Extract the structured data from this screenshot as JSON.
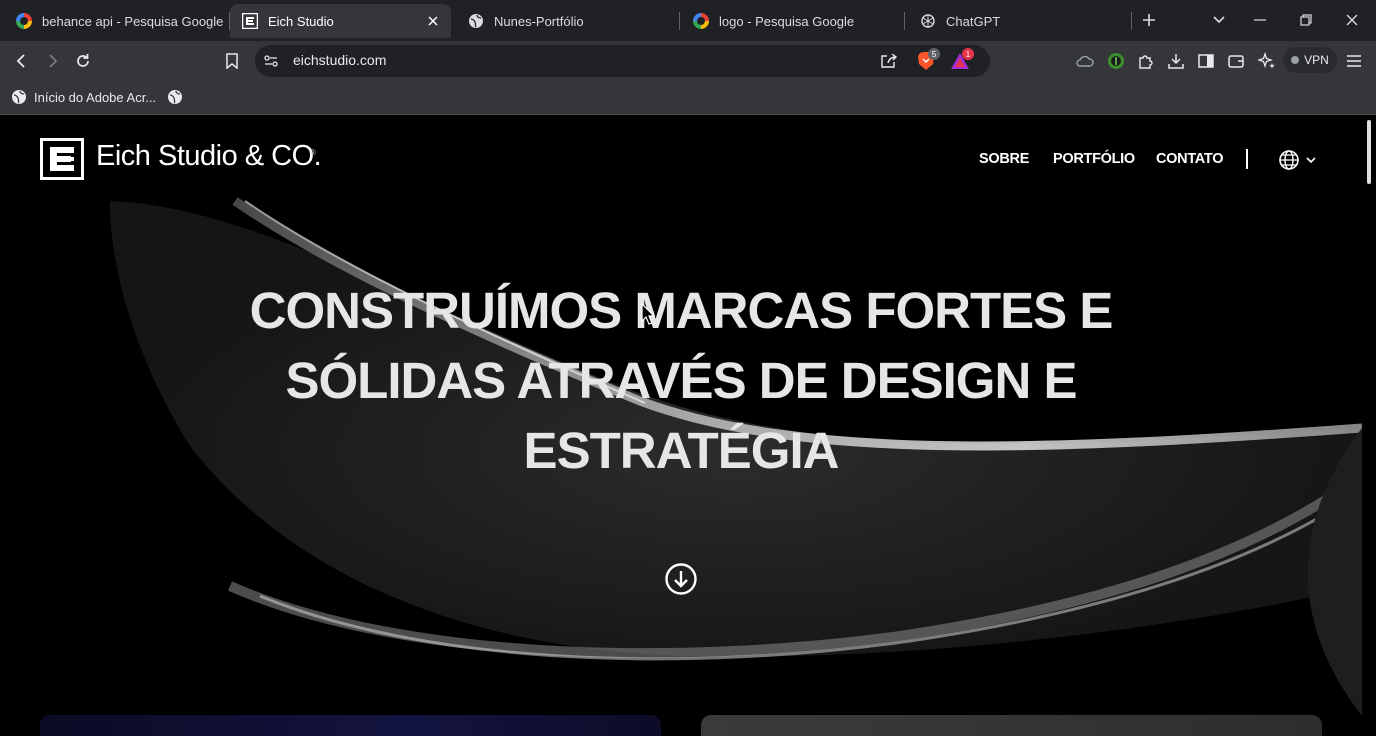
{
  "browser": {
    "tabs": [
      {
        "title": "behance api - Pesquisa Google",
        "icon": "google-icon"
      },
      {
        "title": "Eich Studio",
        "icon": "eich-studio-icon",
        "active": true
      },
      {
        "title": "Nunes-Portfólio",
        "icon": "globe-icon"
      },
      {
        "title": "logo - Pesquisa Google",
        "icon": "google-icon"
      },
      {
        "title": "ChatGPT",
        "icon": "chatgpt-icon"
      }
    ],
    "url": "eichstudio.com",
    "brave_shield_count": "5",
    "rewards_count": "1",
    "vpn_label": "VPN",
    "bookmarks": [
      {
        "label": "Início do Adobe Acr...",
        "icon": "globe-icon"
      },
      {
        "label": "",
        "icon": "globe-icon"
      }
    ]
  },
  "site": {
    "logo_text": "Eich Studio & CO.",
    "logo_mark": "®",
    "nav": {
      "sobre": "SOBRE",
      "portfolio": "PORTFÓLIO",
      "contato": "CONTATO"
    },
    "hero": {
      "line1": "CONSTRUÍMOS MARCAS FORTES E",
      "line2": "SÓLIDAS ATRAVÉS DE DESIGN E",
      "line3": "ESTRATÉGIA"
    }
  },
  "colors": {
    "page_bg": "#000000",
    "text": "#ffffff",
    "headline": "#e6e6e6",
    "brave_orange": "#fb542b",
    "rewards": "#e5344a"
  }
}
